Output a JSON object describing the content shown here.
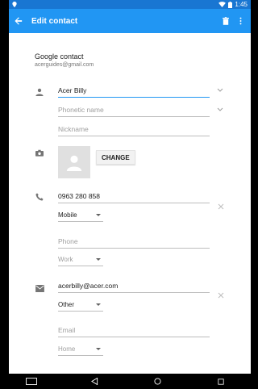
{
  "status_bar": {
    "time": "1:45"
  },
  "app_bar": {
    "title": "Edit contact"
  },
  "account": {
    "title": "Google contact",
    "email": "acerguides@gmail.com"
  },
  "name_section": {
    "name_value": "Acer Billy",
    "phonetic_placeholder": "Phonetic name",
    "nickname_placeholder": "Nickname"
  },
  "photo_section": {
    "change_label": "CHANGE"
  },
  "phone_section": {
    "phone_value": "0963 280 858",
    "phone_type": "Mobile",
    "phone_placeholder": "Phone",
    "new_phone_type": "Work"
  },
  "email_section": {
    "email_value": "acerbilly@acer.com",
    "email_type": "Other",
    "email_placeholder": "Email",
    "new_email_type": "Home"
  },
  "colors": {
    "primary": "#2196F3",
    "primary_dark": "#1976D2",
    "accent_line": "#2196F3"
  },
  "icons": [
    "back-arrow-icon",
    "delete-icon",
    "more-vert-icon",
    "person-icon",
    "camera-icon",
    "phone-icon",
    "email-icon",
    "chevron-down-icon",
    "close-icon",
    "keyboard-icon",
    "back-nav-icon",
    "home-nav-icon",
    "recents-nav-icon"
  ]
}
